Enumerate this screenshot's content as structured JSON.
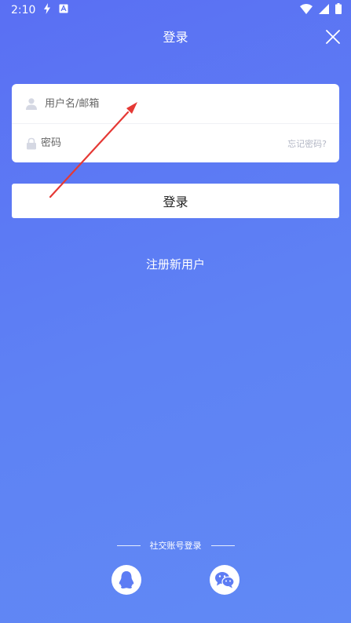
{
  "status_bar": {
    "time": "2:10",
    "icons": [
      "flash-icon",
      "app-notification-icon",
      "wifi-icon",
      "signal-icon",
      "battery-icon"
    ]
  },
  "header": {
    "title": "登录",
    "close_icon": "close-icon"
  },
  "form": {
    "username": {
      "icon": "user-icon",
      "placeholder": "用户名/邮箱",
      "value": ""
    },
    "password": {
      "icon": "lock-icon",
      "placeholder": "密码",
      "value": "",
      "forgot_label": "忘记密码?"
    }
  },
  "actions": {
    "login_label": "登录",
    "register_label": "注册新用户"
  },
  "social": {
    "label": "社交账号登录",
    "providers": [
      {
        "name": "QQ",
        "icon": "qq-penguin-icon"
      },
      {
        "name": "WeChat",
        "icon": "wechat-icon"
      }
    ]
  },
  "colors": {
    "background_start": "#5a6ff3",
    "background_end": "#6189f5",
    "card": "#ffffff",
    "annotation_arrow": "#e53935"
  }
}
